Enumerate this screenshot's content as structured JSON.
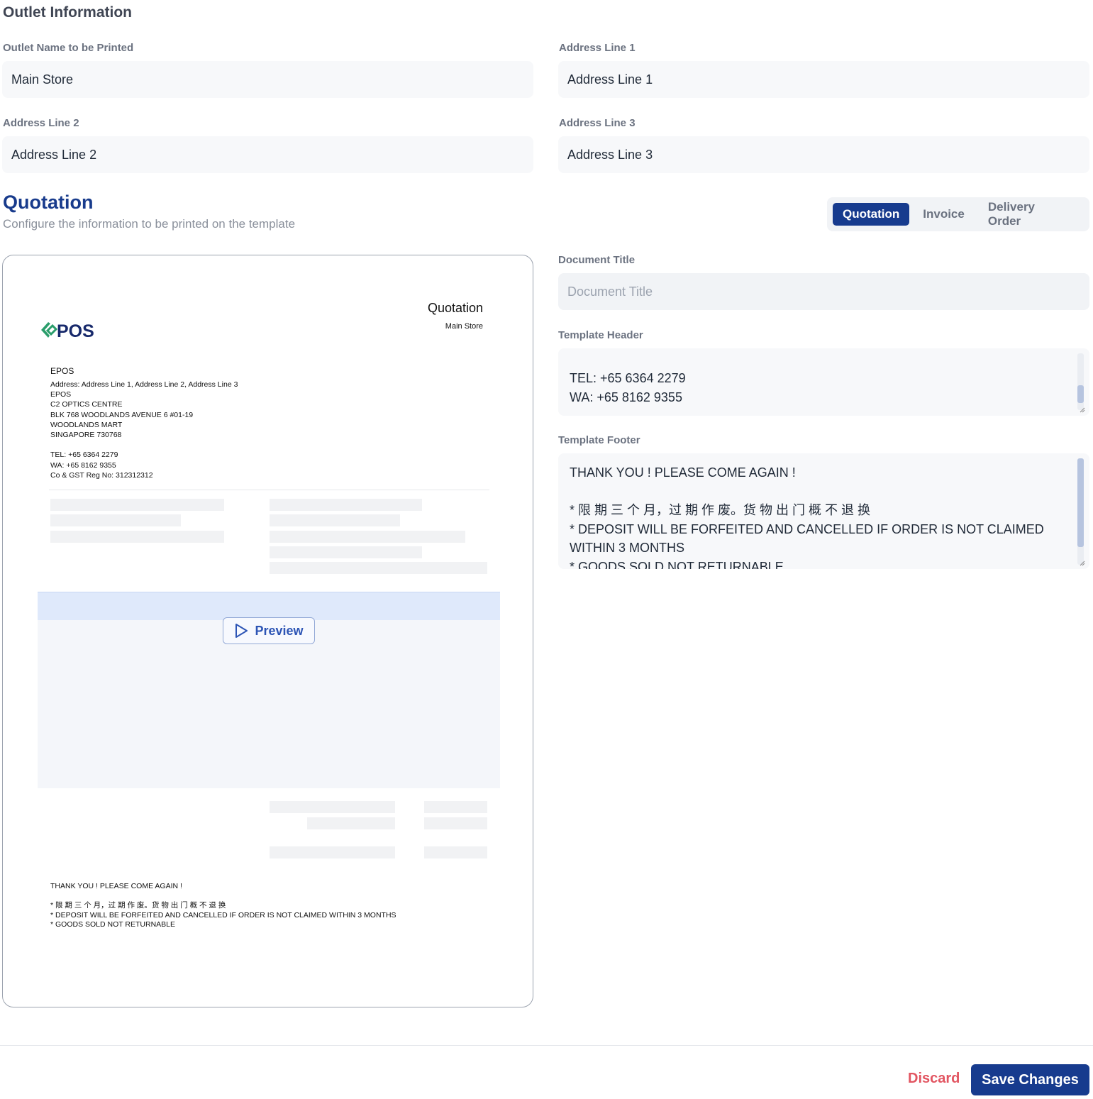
{
  "outlet": {
    "section_title": "Outlet Information",
    "name_label": "Outlet Name to be Printed",
    "name_value": "Main Store",
    "addr1_label": "Address Line 1",
    "addr1_value": "Address Line 1",
    "addr2_label": "Address Line 2",
    "addr2_value": "Address Line 2",
    "addr3_label": "Address Line 3",
    "addr3_value": "Address Line 3"
  },
  "quotation": {
    "heading": "Quotation",
    "subtitle": "Configure the information to be printed on the template"
  },
  "tabs": [
    {
      "label": "Quotation",
      "active": true
    },
    {
      "label": "Invoice",
      "active": false
    },
    {
      "label": "Delivery Order",
      "active": false
    }
  ],
  "preview": {
    "doc_title": "Quotation",
    "store_name": "Main Store",
    "logo_text": "POS",
    "company": "EPOS",
    "address_block": "Address: Address Line 1, Address Line 2, Address Line 3\nEPOS\nC2 OPTICS CENTRE\nBLK 768 WOODLANDS AVENUE 6 #01-19\nWOODLANDS MART\nSINGAPORE 730768\n\nTEL: +65 6364 2279\nWA: +65 8162 9355\nCo & GST Reg No: 312312312",
    "preview_button": "Preview",
    "footer_block": "THANK YOU ! PLEASE COME AGAIN !\n\n* 限 期 三 个 月，过 期 作 废。货 物 出 门 概 不 退 换\n* DEPOSIT WILL BE FORFEITED AND CANCELLED IF ORDER IS NOT CLAIMED WITHIN 3 MONTHS\n* GOODS SOLD NOT RETURNABLE"
  },
  "form": {
    "doc_title_label": "Document Title",
    "doc_title_placeholder": "Document Title",
    "header_label": "Template Header",
    "header_value": "TEL: +65 6364 2279\nWA: +65 8162 9355",
    "footer_label": "Template Footer",
    "footer_value": "THANK YOU ! PLEASE COME AGAIN !\n\n* 限 期 三 个 月，过 期 作 废。货 物 出 门 概 不 退 换\n* DEPOSIT WILL BE FORFEITED AND CANCELLED IF ORDER IS NOT CLAIMED WITHIN 3 MONTHS\n* GOODS SOLD NOT RETURNABLE"
  },
  "actions": {
    "discard": "Discard",
    "save": "Save Changes"
  },
  "colors": {
    "primary": "#173b8e",
    "danger": "#e25561",
    "logo_green": "#2a9d6b"
  },
  "icons": {
    "preview": "play-icon",
    "logo": "epos-logo"
  }
}
